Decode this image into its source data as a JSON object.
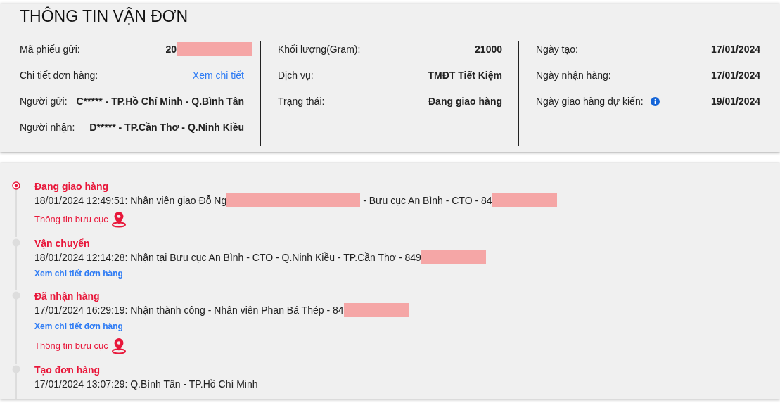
{
  "title": "THÔNG TIN VẬN ĐƠN",
  "info_columns": [
    {
      "items": [
        {
          "label": "Mã phiếu gửi:",
          "value": "20",
          "kind": "text",
          "redacted": true
        },
        {
          "label": "Chi tiết đơn hàng:",
          "value": "Xem chi tiết",
          "kind": "link"
        },
        {
          "label": "Người gửi:",
          "value": "C***** - TP.Hồ Chí Minh - Q.Bình Tân",
          "kind": "text"
        },
        {
          "label": "Người nhận:",
          "value": "D***** - TP.Cần Thơ - Q.Ninh Kiều",
          "kind": "text"
        }
      ]
    },
    {
      "items": [
        {
          "label": "Khối lượng(Gram):",
          "value": "21000",
          "kind": "text"
        },
        {
          "label": "Dịch vụ:",
          "value": "TMĐT Tiết Kiệm",
          "kind": "text"
        },
        {
          "label": "Trạng thái:",
          "value": "Đang giao hàng",
          "kind": "text"
        }
      ]
    },
    {
      "items": [
        {
          "label": "Ngày tạo:",
          "value": "17/01/2024",
          "kind": "text"
        },
        {
          "label": "Ngày nhận hàng:",
          "value": "17/01/2024",
          "kind": "text"
        },
        {
          "label": "Ngày giao hàng dự kiến:",
          "value": "19/01/2024",
          "kind": "text",
          "info": true
        }
      ]
    }
  ],
  "timeline": [
    {
      "title": "Đang giao hàng",
      "active": true,
      "parts": [
        {
          "kind": "text",
          "text": "18/01/2024 12:49:51: Nhân viên giao Đỗ Ng"
        },
        {
          "kind": "redacted"
        },
        {
          "kind": "text",
          "text": "- Bưu cục An Bình - CTO - 84"
        },
        {
          "kind": "redacted"
        }
      ],
      "links": [
        {
          "kind": "office",
          "text": "Thông tin bưu cục"
        }
      ]
    },
    {
      "title": "Vận chuyển",
      "active": false,
      "parts": [
        {
          "kind": "text",
          "text": "18/01/2024 12:14:28: Nhận tại Bưu cục An Bình - CTO - Q.Ninh Kiều - TP.Cần Thơ - 849"
        },
        {
          "kind": "redacted"
        }
      ],
      "links": [
        {
          "kind": "order",
          "text": "Xem chi tiết đơn hàng"
        }
      ]
    },
    {
      "title": "Đã nhận hàng",
      "active": false,
      "parts": [
        {
          "kind": "text",
          "text": "17/01/2024 16:29:19: Nhận thành công - Nhân viên Phan Bá Thép - 84"
        },
        {
          "kind": "redacted"
        }
      ],
      "links": [
        {
          "kind": "order",
          "text": "Xem chi tiết đơn hàng"
        },
        {
          "kind": "office",
          "text": "Thông tin bưu cục"
        }
      ]
    },
    {
      "title": "Tạo đơn hàng",
      "active": false,
      "parts": [
        {
          "kind": "text",
          "text": "17/01/2024 13:07:29: Q.Bình Tân - TP.Hồ Chí Minh"
        }
      ]
    }
  ]
}
